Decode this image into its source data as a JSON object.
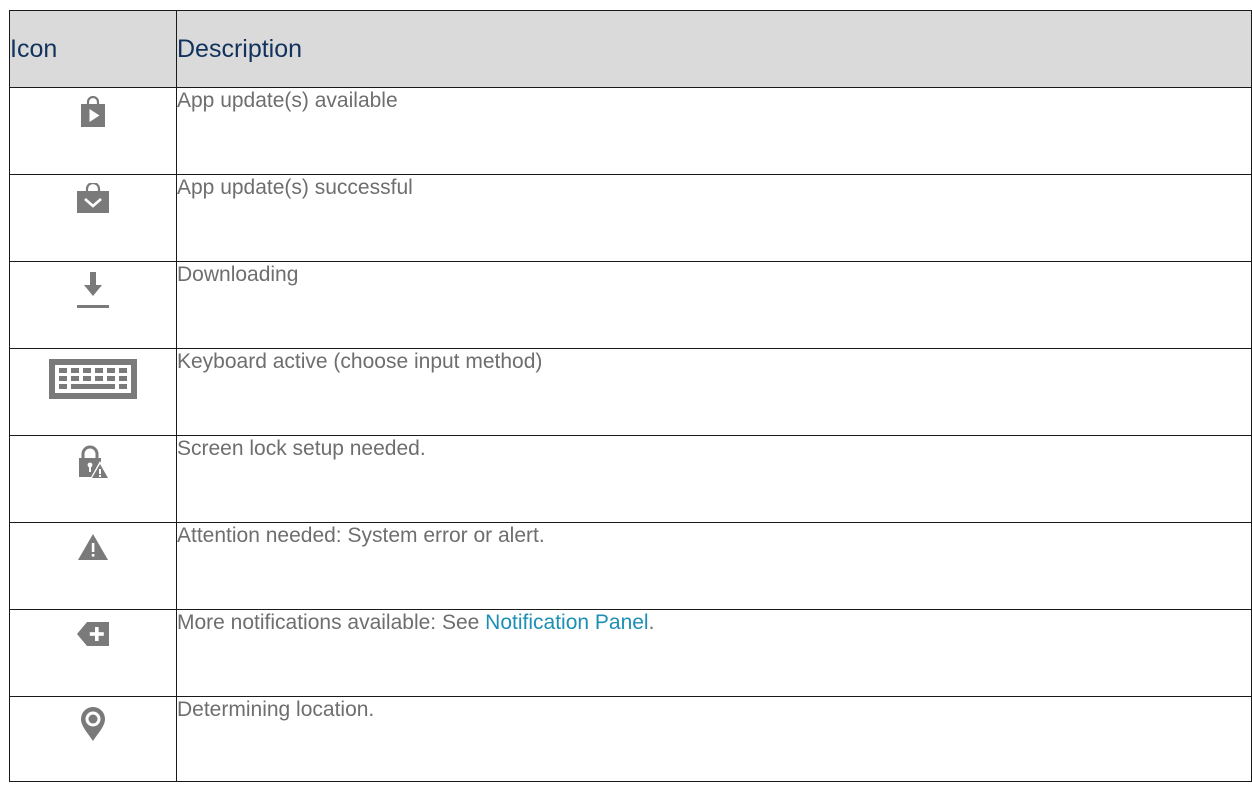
{
  "table": {
    "headers": {
      "icon": "Icon",
      "description": "Description"
    },
    "rows": [
      {
        "icon": "play-store-update-icon",
        "description": "App update(s) available"
      },
      {
        "icon": "play-store-check-icon",
        "description": "App update(s) successful"
      },
      {
        "icon": "download-icon",
        "description": "Downloading"
      },
      {
        "icon": "keyboard-icon",
        "description": "Keyboard active (choose input method)"
      },
      {
        "icon": "lock-warning-icon",
        "description": "Screen lock setup needed."
      },
      {
        "icon": "warning-icon",
        "description": "Attention needed: System error or alert."
      },
      {
        "icon": "more-notifications-icon",
        "description_prefix": "More notifications available: See ",
        "link_text": "Notification Panel",
        "description_suffix": "."
      },
      {
        "icon": "location-pin-icon",
        "description": "Determining location."
      }
    ]
  },
  "colors": {
    "header_background": "#dadada",
    "header_text": "#12325e",
    "body_text": "#6e6e6e",
    "link": "#1d8fb5",
    "icon_gray": "#7a7a7a",
    "border": "#1a1a1a"
  }
}
